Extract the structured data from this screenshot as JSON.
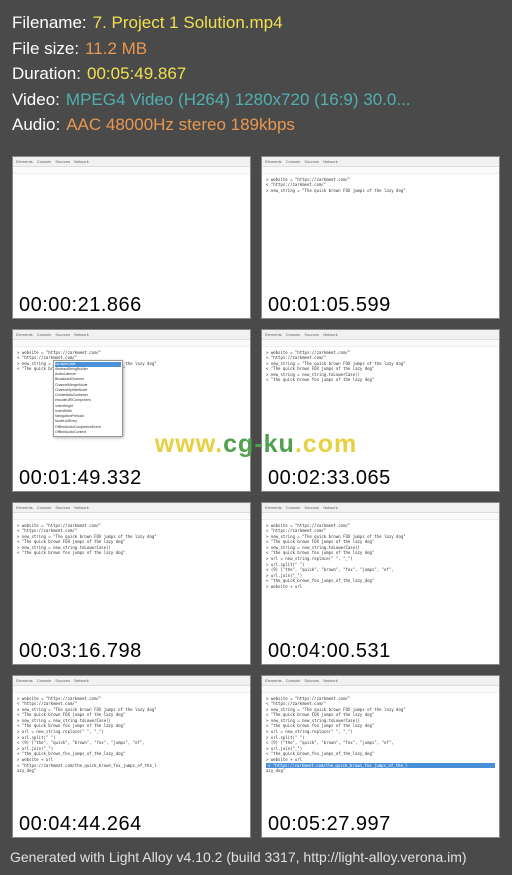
{
  "header": {
    "filename_label": "Filename:",
    "filename": "7. Project 1 Solution.mp4",
    "filesize_label": "File size:",
    "filesize": "11.2 MB",
    "duration_label": "Duration:",
    "duration": "00:05:49.867",
    "video_label": "Video:",
    "video": "MPEG4 Video (H264) 1280x720 (16:9) 30.0...",
    "audio_label": "Audio:",
    "audio": "AAC 48000Hz stereo 189kbps"
  },
  "devtools_tabs": [
    "Elements",
    "Console",
    "Sources",
    "Network"
  ],
  "thumbnails": [
    {
      "timestamp": "00:00:21.866",
      "lines": 0
    },
    {
      "timestamp": "00:01:05.599",
      "lines": 3
    },
    {
      "timestamp": "00:01:49.332",
      "lines": 4,
      "dropdown": true
    },
    {
      "timestamp": "00:02:33.065",
      "lines": 6
    },
    {
      "timestamp": "00:03:16.798",
      "lines": 6
    },
    {
      "timestamp": "00:04:00.531",
      "lines": 12
    },
    {
      "timestamp": "00:04:44.264",
      "lines": 14
    },
    {
      "timestamp": "00:05:27.997",
      "lines": 14,
      "highlight": true
    }
  ],
  "dropdown_items": [
    "toLowerCase",
    "AbstractStringBuilder",
    "AudioListener",
    "BroadcastChannel",
    "ChannelMergerNode",
    "ChannelSplitterNode",
    "CredentialsContainer",
    "encodeURIComponent",
    "innerHeight",
    "innerWidth",
    "NavigationPreload",
    "NodeListEntry",
    "OfflineAudioCompletionEvent",
    "OfflineAudioContext"
  ],
  "sample_code": [
    "> website = \"https://zarkmeet.com/\"",
    "< \"https://zarkmeet.com/\"",
    "> new_string = \"The quick brown FOX jumps of the lazy dog\"",
    "< \"The quick brown FOX jumps of the lazy dog\"",
    "> new_string = new_string.toLowerCase()",
    "< \"the quick brown fox jumps of the lazy dog\"",
    "> url = new_string.replace(\" \", \"_\")",
    "> url.split(\" \")",
    "< (9) [\"the\", \"quick\", \"brown\", \"fox\", \"jumps\", \"of\",",
    "> url.join(\"_\")",
    "< \"the_quick_brown_fox_jumps_of_the_lazy_dog\"",
    "> website + url",
    "< \"https://zarkmeet.com/the_quick_brown_fox_jumps_of_the_l",
    "azy_dog\""
  ],
  "watermark": {
    "part1": "www.",
    "part2": "cg-ku",
    "part3": ".com"
  },
  "footer": "Generated with Light Alloy v4.10.2 (build 3317, http://light-alloy.verona.im)"
}
